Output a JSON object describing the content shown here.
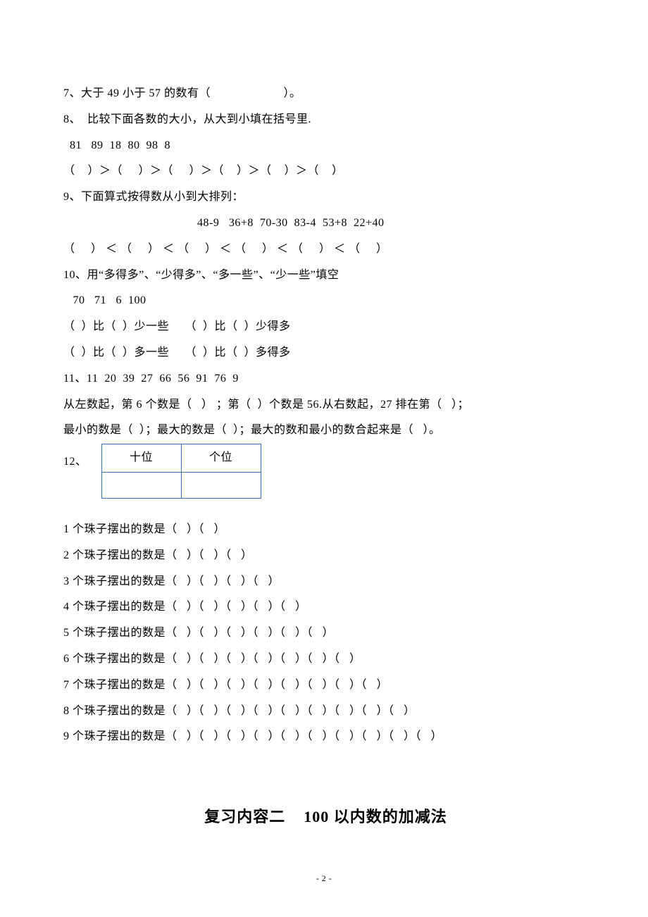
{
  "q7": "7、大于 49 小于 57 的数有（                       ）。",
  "q8_intro": "8、  比较下面各数的大小，从大到小填在括号里.",
  "q8_nums": "  81   89  18  80  98  8",
  "q8_brackets": "（    ）＞（     ）＞（     ）＞（    ）＞（    ）＞（    ）",
  "q9_intro": "9、下面算式按得数从小到大排列：",
  "q9_expr": "48-9   36+8  70-30  83-4  53+8  22+40",
  "q9_brackets": "（     ） ＜ （     ） ＜ （     ） ＜ （     ） ＜ （     ） ＜ （     ）",
  "q10_intro": "10、用“多得多”、“少得多”、“多一些”、“少一些”填空",
  "q10_nums": "   70   71   6  100",
  "q10_l1": "（  ）比（  ）少一些     （  ）比（  ）少得多",
  "q10_l2": "（  ）比（  ）多一些     （  ）比（  ）多得多",
  "q11_nums": "11、11  20  39  27  66  56  91  76  9",
  "q11_l1": "从左数起，第 6 个数是（   ） ；第（  ）个数是 56.从右数起，27 排在第（   ）；",
  "q11_l2": "最小的数是（  ）；最大的数是（  ）；最大的数和最小的数合起来是（   ）。",
  "q12_num": "12、",
  "table_h1": "十位",
  "table_h2": "个位",
  "beads": {
    "b1": "1 个珠子摆出的数是（   ）（   ）",
    "b2": "2 个珠子摆出的数是（   ）（   ）（   ）",
    "b3": "3 个珠子摆出的数是（   ）（   ）（   ）（   ）",
    "b4": "4 个珠子摆出的数是（   ）（   ）（   ）（   ）（   ）",
    "b5": "5 个珠子摆出的数是（   ）（   ）（   ）（   ）（   ）（   ）",
    "b6": "6 个珠子摆出的数是（   ）（   ）（   ）（   ）（   ）（   ）（   ）",
    "b7": "7 个珠子摆出的数是（   ）（   ）（   ）（   ）（   ）（   ）（   ）（   ）",
    "b8": "8 个珠子摆出的数是（   ）（   ）（   ）（   ）（   ）（   ）（   ）（   ）（   ）",
    "b9": "9 个珠子摆出的数是（   ）（   ）（   ）（   ）（   ）（   ）（   ）（   ）（   ）（   ）"
  },
  "heading2": "复习内容二    100 以内数的加减法",
  "page_num": "- 2 -"
}
